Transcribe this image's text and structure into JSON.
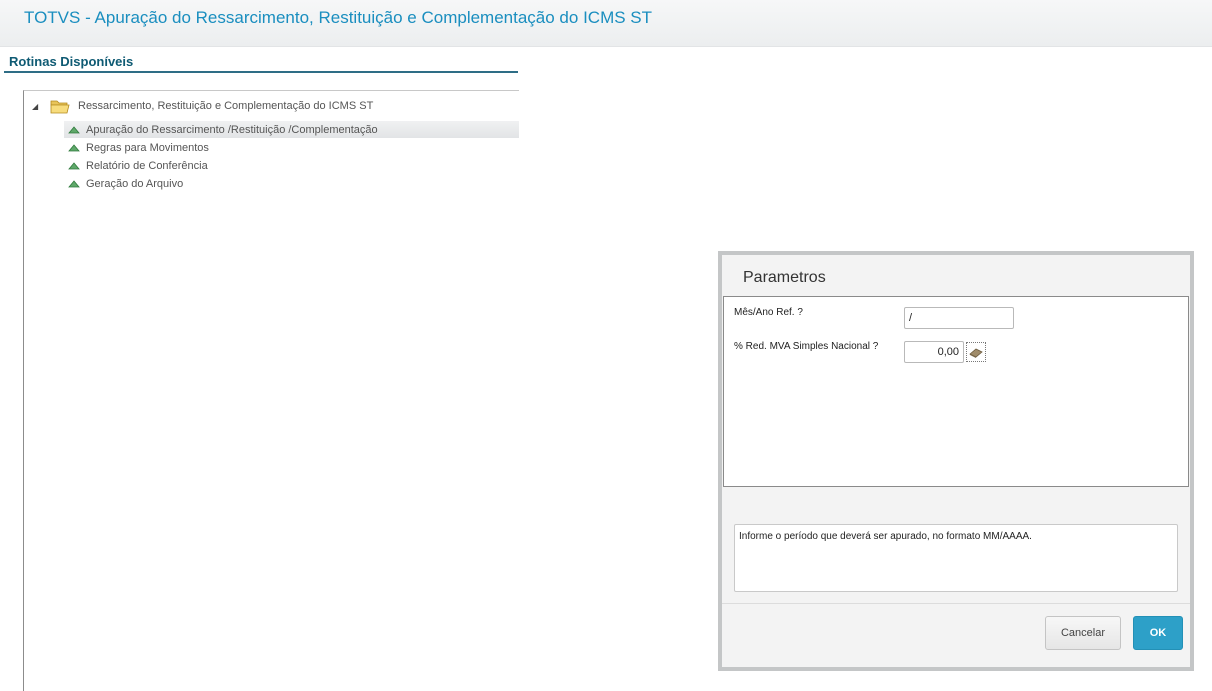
{
  "header": {
    "title": "TOTVS - Apuração do Ressarcimento, Restituição e Complementação do ICMS ST"
  },
  "panel": {
    "title": "Rotinas Disponíveis"
  },
  "tree": {
    "root": {
      "label": "Ressarcimento, Restituição e Complementação do ICMS ST",
      "expander": "◢",
      "icon": "folder-open-icon"
    },
    "children": [
      {
        "label": "Apuração do Ressarcimento /Restituição /Complementação",
        "selected": true
      },
      {
        "label": "Regras para Movimentos",
        "selected": false
      },
      {
        "label": "Relatório de Conferência",
        "selected": false
      },
      {
        "label": "Geração do Arquivo",
        "selected": false
      }
    ]
  },
  "dialog": {
    "title": "Parametros",
    "fields": [
      {
        "label": "Mês/Ano Ref. ?",
        "value": "/"
      },
      {
        "label": "% Red. MVA Simples Nacional ?",
        "value": "0,00"
      }
    ],
    "help_text": "Informe o período que deverá ser apurado, no formato MM/AAAA.",
    "cancel_label": "Cancelar",
    "ok_label": "OK"
  },
  "colors": {
    "header_title": "#1a8ebf",
    "panel_title": "#0e5a73",
    "ok_button": "#2da0c8"
  }
}
